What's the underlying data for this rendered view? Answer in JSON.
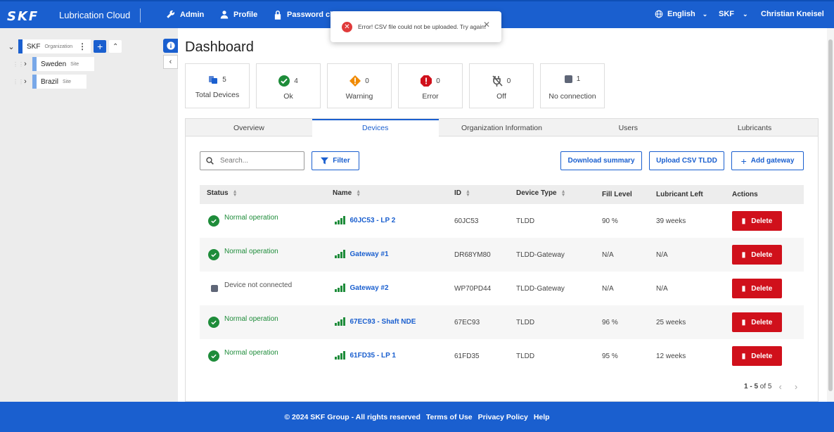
{
  "header": {
    "logo": "SKF",
    "app_name": "Lubrication Cloud",
    "nav": [
      {
        "label": "Admin",
        "icon": "wrench-icon"
      },
      {
        "label": "Profile",
        "icon": "person-icon"
      },
      {
        "label": "Password cha",
        "icon": "lock-icon"
      }
    ],
    "language": "English",
    "organization": "SKF",
    "user": "Christian Kneisel"
  },
  "toast": {
    "message": "Error! CSV file could not be uploaded. Try again!",
    "close_glyph": "✕"
  },
  "sidebar": {
    "root": {
      "name": "SKF",
      "type": "Organization"
    },
    "children": [
      {
        "name": "Sweden",
        "type": "Site"
      },
      {
        "name": "Brazil",
        "type": "Site"
      }
    ]
  },
  "main": {
    "title": "Dashboard",
    "stats": [
      {
        "value": "5",
        "label": "Total Devices",
        "icon": "devices-icon"
      },
      {
        "value": "4",
        "label": "Ok",
        "icon": "check-circle-icon"
      },
      {
        "value": "0",
        "label": "Warning",
        "icon": "warning-diamond-icon"
      },
      {
        "value": "0",
        "label": "Error",
        "icon": "error-octagon-icon"
      },
      {
        "value": "0",
        "label": "Off",
        "icon": "unplugged-icon"
      },
      {
        "value": "1",
        "label": "No connection",
        "icon": "disconnected-square-icon"
      }
    ],
    "tabs": [
      "Overview",
      "Devices",
      "Organization Information",
      "Users",
      "Lubricants"
    ],
    "active_tab": "Devices",
    "search_placeholder": "Search...",
    "filter_label": "Filter",
    "download_label": "Download summary",
    "upload_label": "Upload CSV TLDD",
    "add_gateway_label": "Add gateway",
    "columns": [
      "Status",
      "Name",
      "ID",
      "Device Type",
      "Fill Level",
      "Lubricant Left",
      "Actions"
    ],
    "rows": [
      {
        "status": "Normal operation",
        "name": "60JC53 - LP 2",
        "id": "60JC53",
        "type": "TLDD",
        "fill": "90 %",
        "left": "39 weeks",
        "action": "Delete"
      },
      {
        "status": "Normal operation",
        "name": "Gateway #1",
        "id": "DR68YM80",
        "type": "TLDD-Gateway",
        "fill": "N/A",
        "left": "N/A",
        "action": "Delete"
      },
      {
        "status": "Device not connected",
        "name": "Gateway #2",
        "id": "WP70PD44",
        "type": "TLDD-Gateway",
        "fill": "N/A",
        "left": "N/A",
        "action": "Delete"
      },
      {
        "status": "Normal operation",
        "name": "67EC93 - Shaft NDE",
        "id": "67EC93",
        "type": "TLDD",
        "fill": "96 %",
        "left": "25 weeks",
        "action": "Delete"
      },
      {
        "status": "Normal operation",
        "name": "61FD35 - LP 1",
        "id": "61FD35",
        "type": "TLDD",
        "fill": "95 %",
        "left": "12 weeks",
        "action": "Delete"
      }
    ],
    "pagination": {
      "range": "1 - 5",
      "of": "of 5"
    }
  },
  "footer": {
    "copyright": "© 2024 SKF Group - All rights reserved",
    "links": [
      "Terms of Use",
      "Privacy Policy",
      "Help"
    ]
  },
  "colors": {
    "primary": "#1a5fcf",
    "ok": "#1e8c3a",
    "danger": "#d0101b",
    "warning": "#f08a00"
  }
}
